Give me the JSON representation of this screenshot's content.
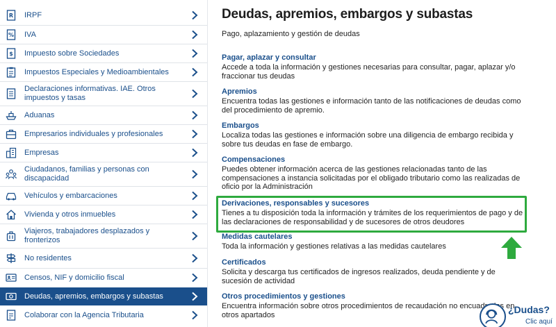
{
  "sidebar": {
    "items": [
      {
        "label": "IRPF",
        "icon": "irpf-document-icon"
      },
      {
        "label": "IVA",
        "icon": "iva-document-icon"
      },
      {
        "label": "Impuesto sobre Sociedades",
        "icon": "sociedades-document-icon"
      },
      {
        "label": "Impuestos Especiales y Medioambientales",
        "icon": "clipboard-icon"
      },
      {
        "label": "Declaraciones informativas. IAE. Otros impuestos y tasas",
        "icon": "form-icon"
      },
      {
        "label": "Aduanas",
        "icon": "ship-icon"
      },
      {
        "label": "Empresarios individuales y profesionales",
        "icon": "briefcase-icon"
      },
      {
        "label": "Empresas",
        "icon": "building-icon"
      },
      {
        "label": "Ciudadanos, familias y personas con discapacidad",
        "icon": "people-icon"
      },
      {
        "label": "Vehículos y embarcaciones",
        "icon": "car-icon"
      },
      {
        "label": "Vivienda y otros inmuebles",
        "icon": "house-icon"
      },
      {
        "label": "Viajeros, trabajadores desplazados y fronterizos",
        "icon": "luggage-icon"
      },
      {
        "label": "No residentes",
        "icon": "signpost-icon"
      },
      {
        "label": "Censos, NIF y domicilio fiscal",
        "icon": "id-card-icon"
      },
      {
        "label": "Deudas, apremios, embargos y subastas",
        "icon": "money-icon",
        "active": true
      },
      {
        "label": "Colaborar con la Agencia Tributaria",
        "icon": "handshake-document-icon"
      }
    ]
  },
  "main": {
    "title": "Deudas, apremios, embargos y subastas",
    "subtitle": "Pago, aplazamiento y gestión de deudas",
    "sections": [
      {
        "title": "Pagar, aplazar y consultar",
        "desc": "Accede a toda la información y gestiones necesarias para consultar, pagar, aplazar y/o fraccionar tus deudas"
      },
      {
        "title": "Apremios",
        "desc": "Encuentra todas las gestiones e información tanto de las notificaciones de deudas como del procedimiento de apremio."
      },
      {
        "title": "Embargos",
        "desc": "Localiza todas las gestiones e información sobre una diligencia de embargo recibida y sobre tus deudas en fase de embargo."
      },
      {
        "title": "Compensaciones",
        "desc": "Puedes obtener información acerca de las gestiones relacionadas tanto de las compensaciones a instancia solicitadas por el obligado tributario como las realizadas de oficio por la Administración"
      },
      {
        "title": "Derivaciones, responsables y sucesores",
        "desc": "Tienes a tu disposición toda la información y trámites de los requerimientos de pago y de las declaraciones de responsabilidad y de sucesores de otros deudores"
      },
      {
        "title": "Medidas cautelares",
        "desc": "Toda la información y gestiones relativas a las medidas cautelares"
      },
      {
        "title": "Certificados",
        "desc": "Solicita y descarga tus certificados de ingresos realizados, deuda pendiente y de sucesión de actividad"
      },
      {
        "title": "Otros procedimientos y gestiones",
        "desc": "Encuentra información sobre otros procedimientos de recaudación no encuadrados en otros apartados"
      }
    ]
  },
  "help": {
    "question": "¿Dudas?",
    "click": "Clic aquí"
  },
  "colors": {
    "brand": "#1a4f8b",
    "highlight": "#2eaa3e"
  }
}
